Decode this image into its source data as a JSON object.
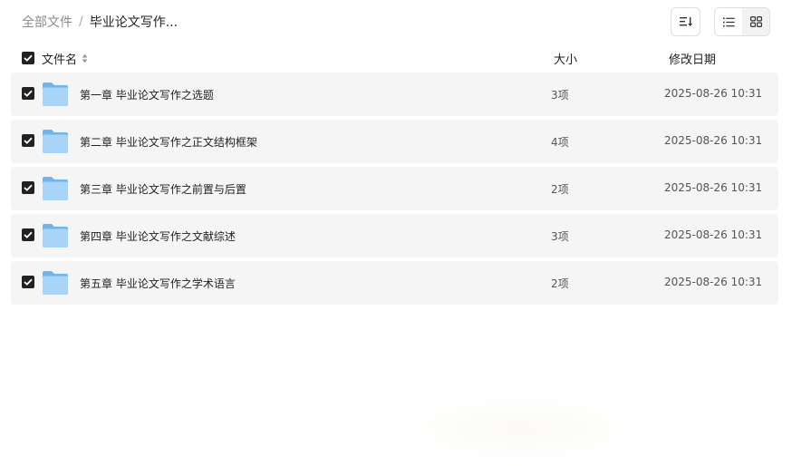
{
  "breadcrumb": {
    "root": "全部文件",
    "separator": "/",
    "current": "毕业论文写作..."
  },
  "toolbar": {
    "sort_icon": "sort-icon",
    "list_view_icon": "list-view-icon",
    "grid_view_icon": "grid-view-icon",
    "active_view": "list"
  },
  "table": {
    "headers": {
      "name": "文件名",
      "size": "大小",
      "date": "修改日期"
    },
    "select_all_checked": true,
    "rows": [
      {
        "name": "第一章 毕业论文写作之选题",
        "count": "3项",
        "date": "2025-08-26 10:31",
        "checked": true,
        "icon": "folder-icon"
      },
      {
        "name": "第二章 毕业论文写作之正文结构框架",
        "count": "4项",
        "date": "2025-08-26 10:31",
        "checked": true,
        "icon": "folder-icon"
      },
      {
        "name": "第三章 毕业论文写作之前置与后置",
        "count": "2项",
        "date": "2025-08-26 10:31",
        "checked": true,
        "icon": "folder-icon"
      },
      {
        "name": "第四章 毕业论文写作之文献综述",
        "count": "3项",
        "date": "2025-08-26 10:31",
        "checked": true,
        "icon": "folder-icon"
      },
      {
        "name": "第五章 毕业论文写作之学术语言",
        "count": "2项",
        "date": "2025-08-26 10:31",
        "checked": true,
        "icon": "folder-icon"
      }
    ]
  },
  "colors": {
    "row_background": "#f5f5f5",
    "checkbox": "#222222",
    "folder_light": "#a8d4f7",
    "folder_dark": "#6fb6ee"
  }
}
